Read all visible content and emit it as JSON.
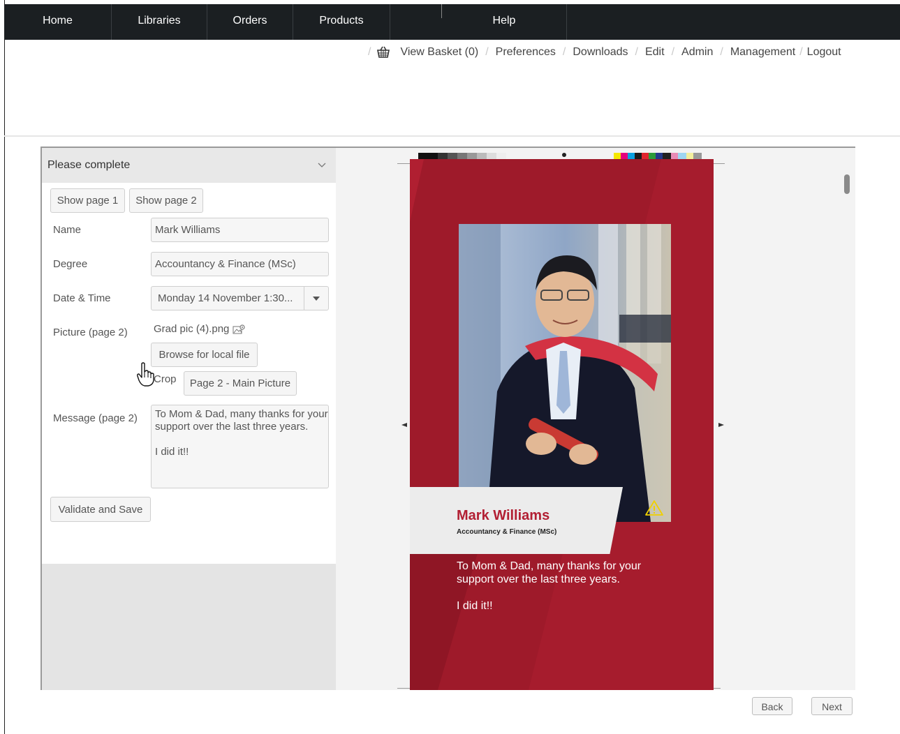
{
  "nav": {
    "items": [
      {
        "label": "Home"
      },
      {
        "label": "Libraries"
      },
      {
        "label": "Orders"
      },
      {
        "label": "Products"
      },
      {
        "label": ""
      },
      {
        "label": "Help"
      }
    ]
  },
  "utility": {
    "basket": "View Basket (0)",
    "preferences": "Preferences",
    "downloads": "Downloads",
    "edit": "Edit",
    "admin": "Admin",
    "management": "Management",
    "logout": "Logout"
  },
  "panel": {
    "title": "Please complete",
    "show_page_1": "Show page 1",
    "show_page_2": "Show page 2",
    "name_label": "Name",
    "name_value": "Mark Williams",
    "degree_label": "Degree",
    "degree_value": "Accountancy & Finance (MSc)",
    "datetime_label": "Date & Time",
    "datetime_value": "Monday 14 November 1:30...",
    "picture_label": "Picture (page 2)",
    "picture_file": "Grad pic (4).png",
    "browse_button": "Browse for local file",
    "crop_label": "Crop",
    "crop_button": "Page 2 - Main Picture",
    "message_label": "Message (page 2)",
    "message_value": "To Mom & Dad, many thanks for your support over the last three years.\n\nI did it!!",
    "validate_button": "Validate  and Save"
  },
  "preview": {
    "name": "Mark Williams",
    "degree": "Accountancy & Finance (MSc)",
    "message": "To Mom & Dad, many thanks for your\nsupport over the last three years.\n\nI did it!!"
  },
  "footer": {
    "back": "Back",
    "next": "Next"
  },
  "colors": {
    "nav_bg": "#1b1f22",
    "brand_red": "#9e1a2a",
    "name_red": "#b21f33"
  }
}
